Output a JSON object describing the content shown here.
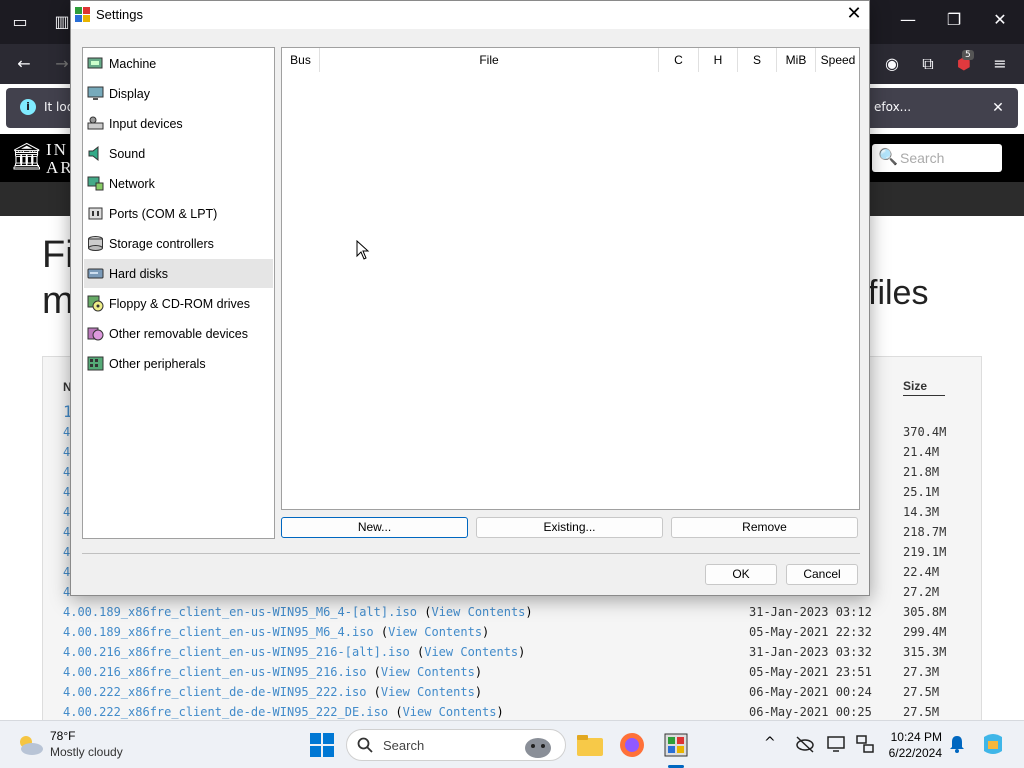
{
  "browser": {
    "notification_text": "It loo",
    "notification_text_end": "efox...",
    "search_placeholder": "Search",
    "ia_logo_text_1": "IN",
    "ia_logo_text_2": "AR",
    "extension_badge": "5",
    "page_title_line1": "Fi",
    "page_title_line2": "m",
    "page_title_end": "files",
    "col_name_frag": "N",
    "col_size": "Size",
    "visible_fragments": [
      "1",
      "4.",
      "4.",
      "4.",
      "4.",
      "4.",
      "4.",
      "4.",
      "4.",
      "4."
    ],
    "partial_sizes": [
      "370.4M",
      "21.4M",
      "21.8M",
      "25.1M",
      "14.3M",
      "218.7M",
      "219.1M",
      "22.4M",
      "27.2M"
    ],
    "rows": [
      {
        "file": "4.00.189_x86fre_client_en-us-WIN95_M6_4-[alt].iso",
        "link": "View Contents",
        "date": "31-Jan-2023 03:12",
        "size": "305.8M"
      },
      {
        "file": "4.00.189_x86fre_client_en-us-WIN95_M6_4.iso",
        "link": "View Contents",
        "date": "05-May-2021 22:32",
        "size": "299.4M"
      },
      {
        "file": "4.00.216_x86fre_client_en-us-WIN95_216-[alt].iso",
        "link": "View Contents",
        "date": "31-Jan-2023 03:32",
        "size": "315.3M"
      },
      {
        "file": "4.00.216_x86fre_client_en-us-WIN95_216.iso",
        "link": "View Contents",
        "date": "05-May-2021 23:51",
        "size": "27.3M"
      },
      {
        "file": "4.00.222_x86fre_client_de-de-WIN95_222.iso",
        "link": "View Contents",
        "date": "06-May-2021 00:24",
        "size": "27.5M"
      },
      {
        "file": "4.00.222_x86fre_client_de-de-WIN95_222_DE.iso",
        "link": "View Contents",
        "date": "06-May-2021 00:25",
        "size": "27.5M"
      }
    ]
  },
  "dialog": {
    "title": "Settings",
    "categories": [
      {
        "label": "Machine",
        "icon": "machine-icon"
      },
      {
        "label": "Display",
        "icon": "display-icon"
      },
      {
        "label": "Input devices",
        "icon": "input-devices-icon"
      },
      {
        "label": "Sound",
        "icon": "sound-icon"
      },
      {
        "label": "Network",
        "icon": "network-icon"
      },
      {
        "label": "Ports (COM & LPT)",
        "icon": "ports-icon"
      },
      {
        "label": "Storage controllers",
        "icon": "storage-controllers-icon"
      },
      {
        "label": "Hard disks",
        "icon": "hard-disks-icon"
      },
      {
        "label": "Floppy & CD-ROM drives",
        "icon": "floppy-cdrom-icon"
      },
      {
        "label": "Other removable devices",
        "icon": "removable-devices-icon"
      },
      {
        "label": "Other peripherals",
        "icon": "peripherals-icon"
      }
    ],
    "selected_category": "Hard disks",
    "table_columns": [
      "Bus",
      "File",
      "C",
      "H",
      "S",
      "MiB",
      "Speed"
    ],
    "buttons": {
      "new": "New...",
      "existing": "Existing...",
      "remove": "Remove",
      "ok": "OK",
      "cancel": "Cancel"
    },
    "close_glyph": "✕"
  },
  "taskbar": {
    "weather_temp": "78°F",
    "weather_desc": "Mostly cloudy",
    "search_text": "Search",
    "time": "10:24 PM",
    "date": "6/22/2024"
  }
}
